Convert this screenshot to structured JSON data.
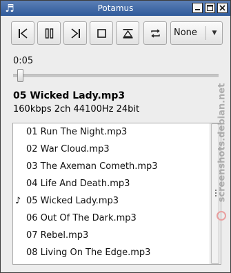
{
  "window": {
    "title": "Potamus",
    "app_icon": "music-note-icon"
  },
  "toolbar": {
    "buttons": [
      {
        "icon": "previous-track-icon"
      },
      {
        "icon": "pause-icon"
      },
      {
        "icon": "next-track-icon"
      },
      {
        "icon": "stop-icon"
      },
      {
        "icon": "eject-icon"
      },
      {
        "icon": "repeat-icon"
      }
    ],
    "mode_select": {
      "value": "None",
      "icon": "dropdown-arrow-icon"
    }
  },
  "player": {
    "position": "0:05",
    "seek_fraction": 0.02,
    "now_playing": "05 Wicked Lady.mp3",
    "stream_info": "160kbps 2ch 44100Hz 24bit"
  },
  "playlist": {
    "playing_icon": "♪",
    "items": [
      {
        "name": "01 Run The Night.mp3",
        "playing": false
      },
      {
        "name": "02 War Cloud.mp3",
        "playing": false
      },
      {
        "name": "03 The Axeman Cometh.mp3",
        "playing": false
      },
      {
        "name": "04 Life And Death.mp3",
        "playing": false
      },
      {
        "name": "05 Wicked Lady.mp3",
        "playing": true
      },
      {
        "name": "06 Out Of The Dark.mp3",
        "playing": false
      },
      {
        "name": "07 Rebel.mp3",
        "playing": false
      },
      {
        "name": "08 Living On The Edge.mp3",
        "playing": false
      }
    ]
  },
  "watermark": {
    "text": "screenshots.debian.net"
  },
  "colors": {
    "titlebar": "#2f5a9a",
    "window_bg": "#ededed",
    "list_bg": "#ffffff"
  }
}
